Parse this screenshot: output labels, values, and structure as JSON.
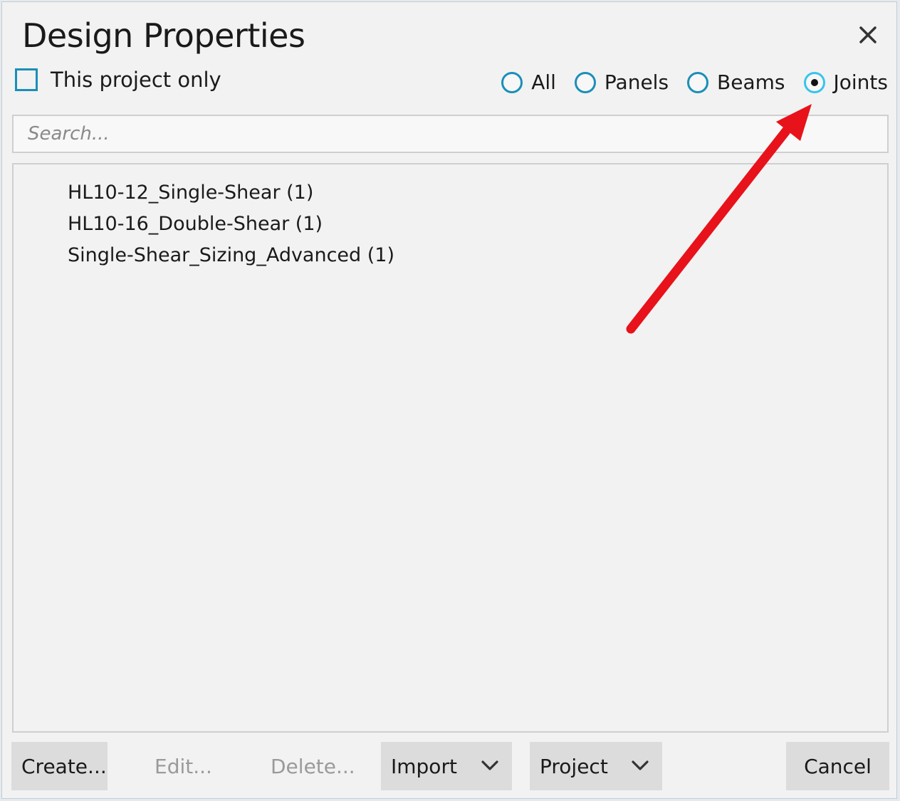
{
  "dialog": {
    "title": "Design Properties",
    "close_icon": "close-icon"
  },
  "filter": {
    "checkbox_label": "This project only",
    "checked": false
  },
  "radios": [
    {
      "label": "All",
      "selected": false
    },
    {
      "label": "Panels",
      "selected": false
    },
    {
      "label": "Beams",
      "selected": false
    },
    {
      "label": "Joints",
      "selected": true
    }
  ],
  "search": {
    "placeholder": "Search...",
    "value": ""
  },
  "list": {
    "items": [
      "HL10-12_Single-Shear (1)",
      "HL10-16_Double-Shear (1)",
      "Single-Shear_Sizing_Advanced (1)"
    ]
  },
  "buttons": {
    "create": "Create...",
    "edit": "Edit...",
    "delete": "Delete...",
    "import": "Import",
    "project": "Project",
    "cancel": "Cancel"
  },
  "icons": {
    "dropdown": "chevron-down-icon",
    "annotation": "red-arrow-annotation"
  },
  "colors": {
    "accent": "#1a8fb8",
    "selected_radio": "#38c4ec",
    "annotation_arrow": "#e8121a",
    "background": "#f2f2f2",
    "button_fill": "#dcdcdc"
  }
}
